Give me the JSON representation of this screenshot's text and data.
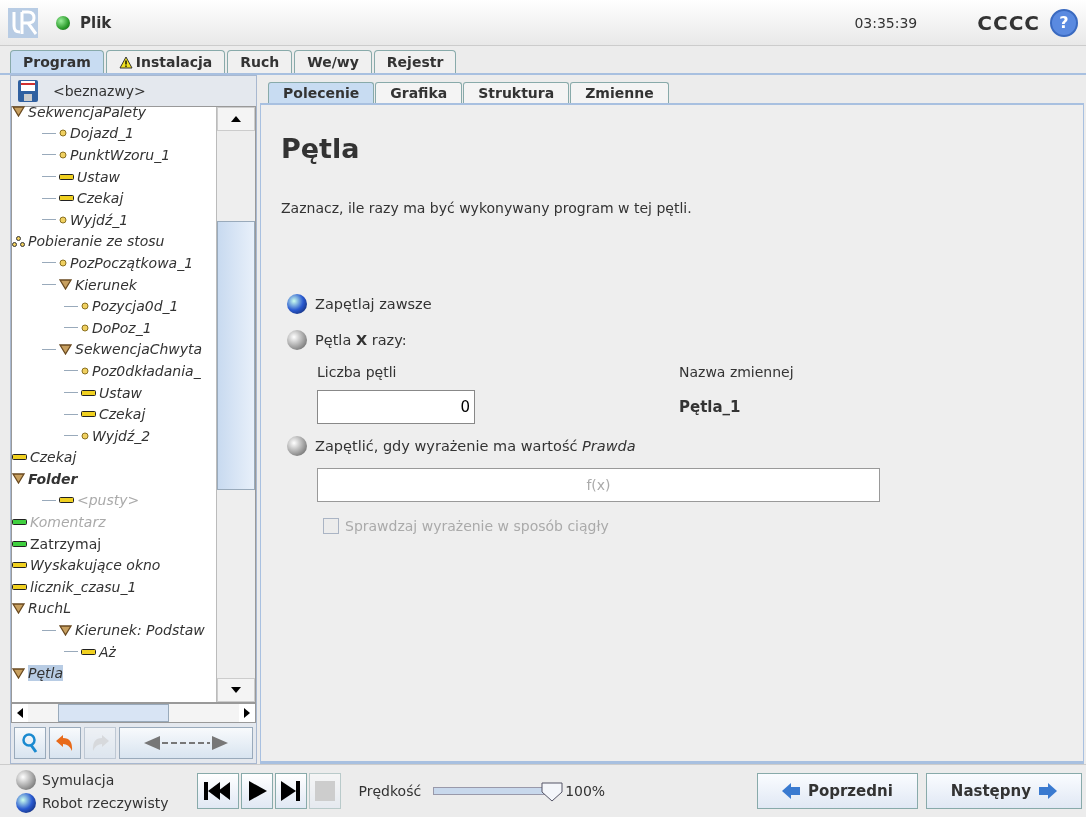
{
  "header": {
    "menu": "Plik",
    "time": "03:35:39",
    "robot_name": "CCCC",
    "help": "?"
  },
  "tabs": [
    {
      "label": "Program",
      "selected": true,
      "warning": false
    },
    {
      "label": "Instalacja",
      "selected": false,
      "warning": true
    },
    {
      "label": "Ruch",
      "selected": false,
      "warning": false
    },
    {
      "label": "We/wy",
      "selected": false,
      "warning": false
    },
    {
      "label": "Rejestr",
      "selected": false,
      "warning": false
    }
  ],
  "program": {
    "filename": "<beznazwy>"
  },
  "tree": [
    {
      "label": "SekwencjaPalety",
      "kind": "folder",
      "disabled": false,
      "selected": false,
      "children": [
        {
          "label": "Dojazd_1",
          "kind": "waypoint",
          "disabled": false,
          "selected": false
        },
        {
          "label": "PunktWzoru_1",
          "kind": "waypoint",
          "disabled": false,
          "selected": false
        },
        {
          "label": "Ustaw",
          "kind": "command",
          "disabled": false,
          "selected": false
        },
        {
          "label": "Czekaj",
          "kind": "command",
          "disabled": false,
          "selected": false
        },
        {
          "label": "Wyjdź_1",
          "kind": "waypoint",
          "disabled": false,
          "selected": false
        }
      ]
    },
    {
      "label": "Pobieranie ze stosu",
      "kind": "pallet",
      "disabled": false,
      "selected": false,
      "children": [
        {
          "label": "PozPoczątkowa_1",
          "kind": "waypoint",
          "disabled": false,
          "selected": false
        },
        {
          "label": "Kierunek",
          "kind": "folder",
          "disabled": false,
          "selected": false,
          "children": [
            {
              "label": "Pozycja0d_1",
              "kind": "waypoint",
              "disabled": false,
              "selected": false
            },
            {
              "label": "DoPoz_1",
              "kind": "waypoint",
              "disabled": false,
              "selected": false
            }
          ]
        },
        {
          "label": "SekwencjaChwyta",
          "kind": "folder",
          "disabled": false,
          "selected": false,
          "children": [
            {
              "label": "Poz0dkładania_",
              "kind": "waypoint",
              "disabled": false,
              "selected": false
            },
            {
              "label": "Ustaw",
              "kind": "command",
              "disabled": false,
              "selected": false
            },
            {
              "label": "Czekaj",
              "kind": "command",
              "disabled": false,
              "selected": false
            },
            {
              "label": "Wyjdź_2",
              "kind": "waypoint",
              "disabled": false,
              "selected": false
            }
          ]
        }
      ]
    },
    {
      "label": "Czekaj",
      "kind": "command",
      "disabled": false,
      "selected": false
    },
    {
      "label": "Folder",
      "kind": "folder",
      "disabled": false,
      "selected": false,
      "children": [
        {
          "label": "<pusty>",
          "kind": "command",
          "disabled": true,
          "selected": false
        }
      ]
    },
    {
      "label": "Komentarz",
      "kind": "comment",
      "disabled": true,
      "selected": false
    },
    {
      "label": "Zatrzymaj",
      "kind": "halt",
      "disabled": false,
      "selected": false
    },
    {
      "label": "Wyskakujące okno",
      "kind": "command",
      "disabled": false,
      "selected": false
    },
    {
      "label": "licznik_czasu_1",
      "kind": "command",
      "disabled": false,
      "selected": false
    },
    {
      "label": "RuchL",
      "kind": "folder",
      "disabled": false,
      "selected": false,
      "children": [
        {
          "label": "Kierunek: Podstaw",
          "kind": "folder",
          "disabled": false,
          "selected": false,
          "children": [
            {
              "label": "Aż",
              "kind": "command",
              "disabled": false,
              "selected": false
            }
          ]
        }
      ]
    },
    {
      "label": "Pętla",
      "kind": "folder",
      "disabled": false,
      "selected": true
    }
  ],
  "tree_tools": [
    {
      "kind": "search",
      "disabled": false
    },
    {
      "kind": "undo",
      "disabled": false
    },
    {
      "kind": "redo",
      "disabled": true
    },
    {
      "kind": "move",
      "disabled": false
    }
  ],
  "subtabs": [
    {
      "label": "Polecenie",
      "selected": true
    },
    {
      "label": "Grafika",
      "selected": false
    },
    {
      "label": "Struktura",
      "selected": false
    },
    {
      "label": "Zmienne",
      "selected": false
    }
  ],
  "command": {
    "title": "Pętla",
    "description": "Zaznacz, ile razy ma być wykonywany program w tej pętli.",
    "options": [
      {
        "label": "Zapętlaj zawsze",
        "selected": true
      },
      {
        "label": "Pętla **X** razy:",
        "selected": false
      },
      {
        "label": "Zapętlić, gdy wyrażenie ma wartość *Prawda*",
        "selected": false
      }
    ],
    "count_label": "Liczba pętli",
    "count_value": "0",
    "variable_label": "Nazwa zmiennej",
    "variable_value": "Pętla_1",
    "expression_placeholder": "f(x)",
    "continuous_check": {
      "label": "Sprawdzaj wyrażenie w sposób ciągły",
      "checked": false,
      "disabled": true
    }
  },
  "footer": {
    "modes": [
      {
        "label": "Symulacja",
        "selected": false
      },
      {
        "label": "Robot rzeczywisty",
        "selected": true
      }
    ],
    "transport": [
      {
        "kind": "rewind",
        "disabled": false
      },
      {
        "kind": "play",
        "disabled": false
      },
      {
        "kind": "step",
        "disabled": false
      },
      {
        "kind": "stop",
        "disabled": true
      }
    ],
    "speed_label": "Prędkość",
    "speed": {
      "level": 1.0
    },
    "speed_value": "100%",
    "prev": "Poprzedni",
    "next": "Następny"
  }
}
